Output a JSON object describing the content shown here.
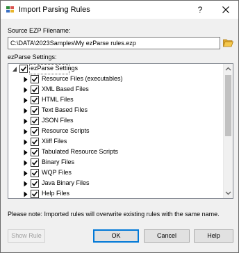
{
  "window": {
    "title": "Import Parsing Rules",
    "help_glyph": "?",
    "app_icon": "import-rules-icon",
    "close_icon": "close-icon"
  },
  "source": {
    "label": "Source EZP Filename:",
    "value": "C:\\DATA\\2023Samples\\My ezParse rules.ezp",
    "browse_icon": "folder-icon"
  },
  "settings": {
    "label": "ezParse Settings:",
    "root": {
      "label": "ezParse Settings",
      "checked": true,
      "expanded": true
    },
    "items": [
      {
        "label": "Resource Files (executables)",
        "checked": true
      },
      {
        "label": "XML Based Files",
        "checked": true
      },
      {
        "label": "HTML Files",
        "checked": true
      },
      {
        "label": "Text Based Files",
        "checked": true
      },
      {
        "label": "JSON Files",
        "checked": true
      },
      {
        "label": "Resource Scripts",
        "checked": true
      },
      {
        "label": "Xliff Files",
        "checked": true
      },
      {
        "label": "Tabulated Resource Scripts",
        "checked": true
      },
      {
        "label": "Binary Files",
        "checked": true
      },
      {
        "label": "WQP Files",
        "checked": true
      },
      {
        "label": "Java Binary Files",
        "checked": true
      },
      {
        "label": "Help Files",
        "checked": true
      }
    ]
  },
  "note": "Please note: Imported rules will overwrite existing rules with the same name.",
  "buttons": {
    "show_rule": "Show Rule",
    "ok": "OK",
    "cancel": "Cancel",
    "help": "Help"
  }
}
